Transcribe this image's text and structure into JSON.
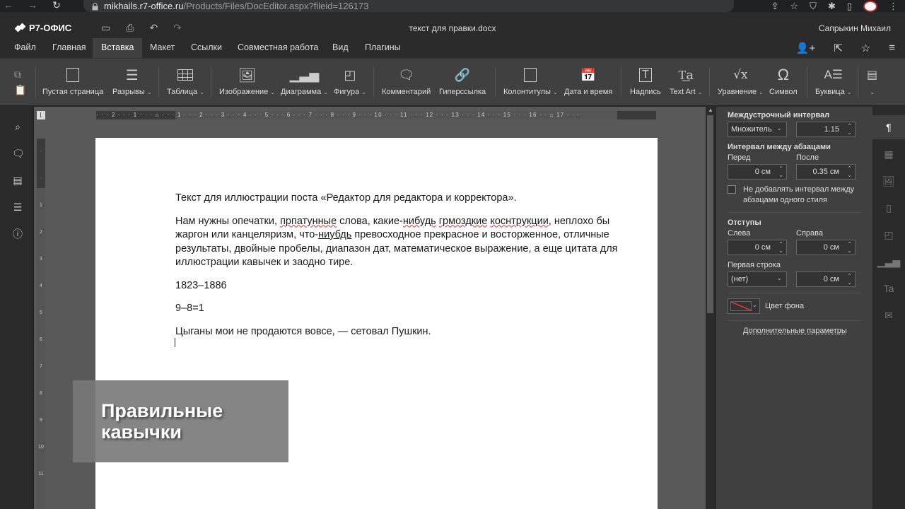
{
  "browser": {
    "url_host": "mikhails.r7-office.ru",
    "url_path": "/Products/Files/DocEditor.aspx?fileid=126173"
  },
  "app": {
    "brand": "Р7-ОФИС",
    "doc_title": "текст для правки.docx",
    "user": "Сапрыкин Михаил"
  },
  "menu": {
    "tabs": [
      "Файл",
      "Главная",
      "Вставка",
      "Макет",
      "Ссылки",
      "Совместная работа",
      "Вид",
      "Плагины"
    ],
    "active": "Вставка"
  },
  "toolbar": {
    "items": [
      "Пустая страница",
      "Разрывы",
      "Таблица",
      "Изображение",
      "Диаграмма",
      "Фигура",
      "Комментарий",
      "Гиперссылка",
      "Колонтитулы",
      "Дата и время",
      "Надпись",
      "Text Art",
      "Уравнение",
      "Символ",
      "Буквица"
    ]
  },
  "document": {
    "p1": "Текст для иллюстрации поста «Редактор для редактора и корректора».",
    "p2_parts": [
      "Нам нужны опечатки, ",
      "прпатунные",
      " слова, какие-",
      "нибудь",
      " ",
      "грмоздкие",
      " ",
      "коснтрукции",
      ", неплохо бы жаргон или канцеляризм, что-",
      "ниубдь",
      " превосходное прекрасное и восторженное, отличные результаты, двойные пробелы, диапазон дат, математическое выражение, а еще цитата для иллюстрации кавычек и заодно тире."
    ],
    "p3": "1823–1886",
    "p4": "9–8=1",
    "p5": "Цыганы мои не продаются вовсе, — сетовал Пушкин."
  },
  "overlay": {
    "line1": "Правильные",
    "line2": "кавычки"
  },
  "settings": {
    "line_spacing_label": "Междустрочный интервал",
    "line_spacing_type": "Множитель",
    "line_spacing_value": "1.15",
    "para_spacing_label": "Интервал между абзацами",
    "before_label": "Перед",
    "after_label": "После",
    "before_value": "0 см",
    "after_value": "0.35 см",
    "no_spacing_same_style": "Не добавлять интервал между абзацами одного стиля",
    "indents_label": "Отступы",
    "left_label": "Слева",
    "right_label": "Справа",
    "left_value": "0 см",
    "right_value": "0 см",
    "first_line_label": "Первая строка",
    "first_line_type": "(нет)",
    "first_line_value": "0 см",
    "bg_color_label": "Цвет фона",
    "advanced_link": "Дополнительные параметры"
  },
  "colors": {
    "accent": "#404040",
    "spell_error": "#d32f2f",
    "page": "#ffffff"
  }
}
